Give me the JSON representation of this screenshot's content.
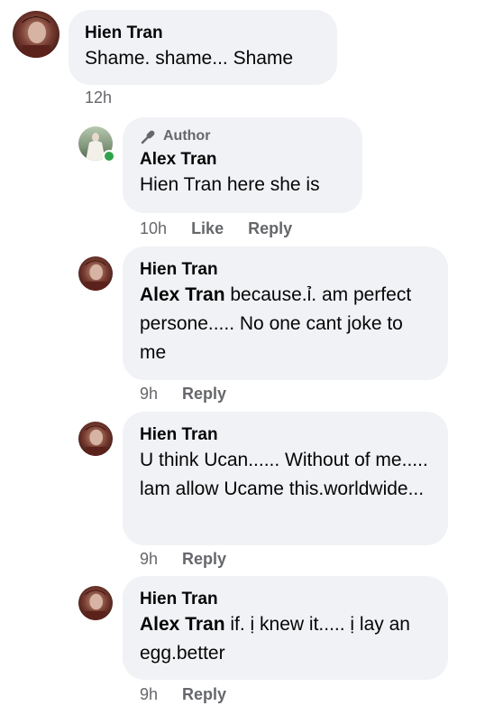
{
  "comments": [
    {
      "author": "Hien Tran",
      "text": "Shame. shame... Shame",
      "time": "12h",
      "avatar_icon": "woman-portrait-avatar"
    },
    {
      "badge": "Author",
      "author": "Alex Tran",
      "text": "Hien Tran here she is",
      "time": "10h",
      "like_label": "Like",
      "reply_label": "Reply",
      "avatar_icon": "bride-outdoor-avatar",
      "online": true
    },
    {
      "author": "Hien Tran",
      "mention": "Alex Tran",
      "text": " because.ỉ. am perfect persone..... No one cant joke to me",
      "time": "9h",
      "reply_label": "Reply",
      "avatar_icon": "woman-portrait-avatar"
    },
    {
      "author": "Hien Tran",
      "text": "U think Ucan...... Without of me..... lam allow Ucame this.worldwide...",
      "time": "9h",
      "reply_label": "Reply",
      "avatar_icon": "woman-portrait-avatar"
    },
    {
      "author": "Hien Tran",
      "mention": "Alex Tran",
      "text": " if. ị knew it..... ị lay an egg.better",
      "time": "9h",
      "reply_label": "Reply",
      "avatar_icon": "woman-portrait-avatar"
    }
  ],
  "colors": {
    "bubble_bg": "#f0f2f5",
    "meta_text": "#65676b",
    "online": "#31a24c"
  }
}
